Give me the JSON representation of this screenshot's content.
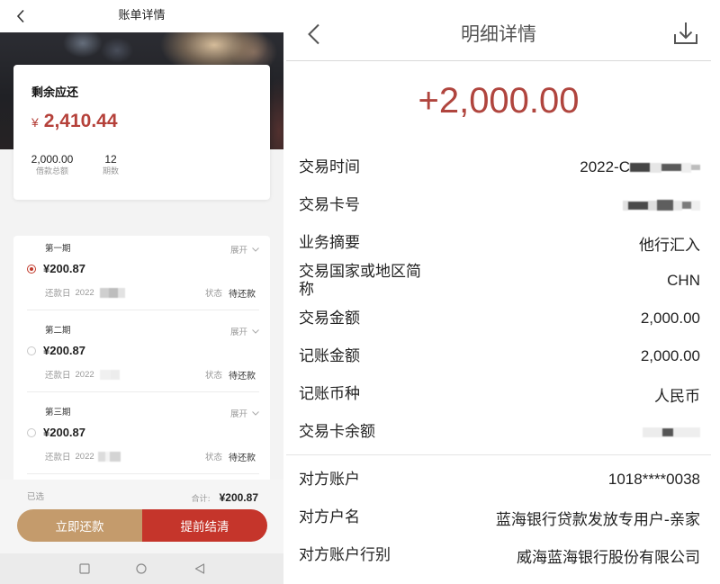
{
  "left": {
    "header": {
      "title": "账单详情"
    },
    "summary": {
      "remaining_label": "剩余应还",
      "currency": "¥",
      "remaining_amount": "2,410.44",
      "loan_total": "2,000.00",
      "loan_total_label": "借款总额",
      "periods": "12",
      "periods_label": "期数"
    },
    "installments": [
      {
        "period": "第一期",
        "expand": "展开",
        "amount": "¥200.87",
        "due_label": "还款日",
        "due_date": "2022",
        "due_redacted": true,
        "status_label": "状态",
        "status": "待还款",
        "selected": true
      },
      {
        "period": "第二期",
        "expand": "展开",
        "amount": "¥200.87",
        "due_label": "还款日",
        "due_date": "2022",
        "due_redacted": true,
        "status_label": "状态",
        "status": "待还款",
        "selected": false
      },
      {
        "period": "第三期",
        "expand": "展开",
        "amount": "¥200.87",
        "due_label": "还款日",
        "due_date": "2022",
        "due_redacted": true,
        "status_label": "状态",
        "status": "待还款",
        "selected": false
      }
    ],
    "footer": {
      "selected_label": "已选",
      "total_label": "合计:",
      "total_amount": "¥200.87"
    },
    "actions": {
      "repay_now": "立即还款",
      "early_settle": "提前结清"
    }
  },
  "right": {
    "header": {
      "title": "明细详情"
    },
    "amount": "+2,000.00",
    "details": [
      {
        "label": "交易时间",
        "value": "2022-C",
        "redacted": true
      },
      {
        "label": "交易卡号",
        "redacted": true
      },
      {
        "label": "业务摘要",
        "value": "他行汇入"
      },
      {
        "label": "交易国家或地区简称",
        "value": "CHN"
      },
      {
        "label": "交易金额",
        "value": "2,000.00"
      },
      {
        "label": "记账金额",
        "value": "2,000.00"
      },
      {
        "label": "记账币种",
        "value": "人民币"
      },
      {
        "label": "交易卡余额",
        "redacted": true
      }
    ],
    "counterparty": [
      {
        "label": "对方账户",
        "value": "1018****0038"
      },
      {
        "label": "对方户名",
        "value": "蓝海银行贷款发放专用户-亲家"
      },
      {
        "label": "对方账户行别",
        "value": "威海蓝海银行股份有限公司"
      }
    ]
  },
  "icons": {
    "left_back": "chevron-left-icon",
    "right_back": "chevron-left-icon",
    "download": "download-icon",
    "expand": "chevron-down-icon",
    "nav": [
      "square-icon",
      "circle-icon",
      "triangle-back-icon"
    ]
  },
  "colors": {
    "amount_red": "#b5413a",
    "big_amount": "#b0453e",
    "repay_gold": "#c49b6c",
    "settle_red": "#c5352b",
    "radio_selected": "#c0392b"
  }
}
